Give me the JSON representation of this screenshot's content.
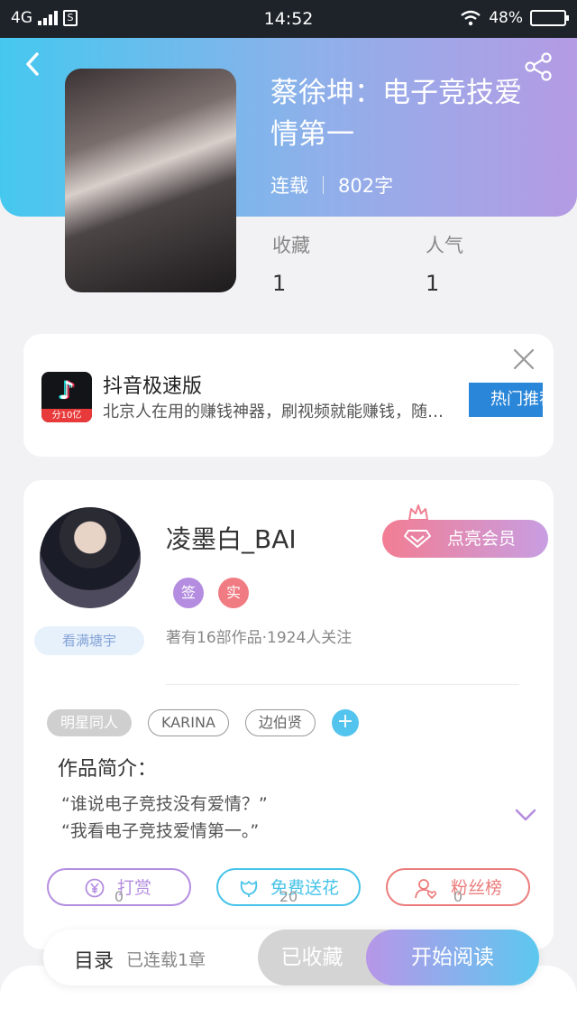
{
  "status_bar": {
    "network": "4G",
    "sim": "S",
    "time": "14:52",
    "battery": "48%"
  },
  "book": {
    "title": "蔡徐坤：电子竞技爱情第一",
    "status": "连载",
    "word_count": "802字",
    "stats": [
      {
        "label": "收藏",
        "value": "1"
      },
      {
        "label": "人气",
        "value": "1"
      }
    ]
  },
  "ad": {
    "app_name": "抖音极速版",
    "icon_strip": "分10亿",
    "description": "北京人在用的赚钱神器，刷视频就能赚钱，随…",
    "button": "热门推荐"
  },
  "author": {
    "name": "凌墨白_BAI",
    "badge": "看满塘宇",
    "vip_button": "点亮会员",
    "badges": [
      {
        "label": "签",
        "color": "#b48de0"
      },
      {
        "label": "实",
        "color": "#f07b82"
      }
    ],
    "stats": "著有16部作品·1924人关注"
  },
  "tags": [
    "明星同人",
    "KARINA",
    "边伯贤"
  ],
  "tag_add": "+",
  "intro": {
    "title": "作品简介：",
    "lines": [
      "“谁说电子竞技没有爱情？”",
      "“我看电子竞技爱情第一。”"
    ]
  },
  "actions": [
    {
      "label": "打赏",
      "count": "0",
      "color": "#b48de0"
    },
    {
      "label": "免费送花",
      "count": "20",
      "color": "#46c3e8"
    },
    {
      "label": "粉丝榜",
      "count": "0",
      "color": "#ec7c7c"
    }
  ],
  "bottom_bar": {
    "toc_label": "目录",
    "toc_sub": "已连载1章",
    "fav_button": "已收藏",
    "read_button": "开始阅读"
  },
  "colors": {
    "accent_start": "#45c8ef",
    "accent_end": "#b49be4",
    "ad_button": "#2a86d8"
  }
}
